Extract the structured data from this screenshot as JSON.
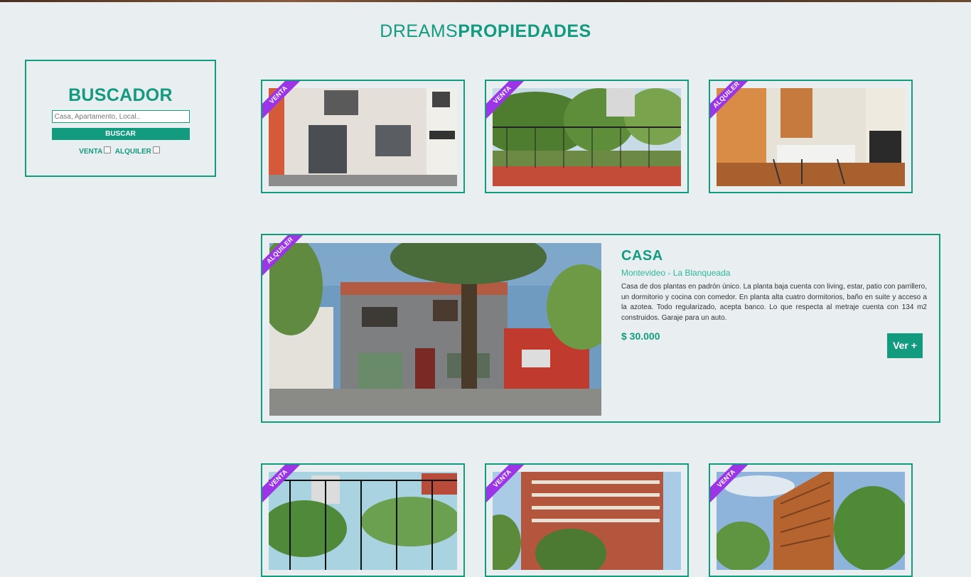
{
  "brand": {
    "light": "DREAMS",
    "bold": "PROPIEDADES"
  },
  "search": {
    "title": "BUSCADOR",
    "placeholder": "Casa, Apartamento, Local..",
    "button": "BUSCAR",
    "filter_venta": "VENTA",
    "filter_alquiler": "ALQUILER"
  },
  "listings_top": [
    {
      "tag": "VENTA"
    },
    {
      "tag": "VENTA"
    },
    {
      "tag": "ALQUILER"
    }
  ],
  "featured": {
    "tag": "ALQUILER",
    "title": "CASA",
    "location": "Montevideo - La Blanqueada",
    "description": "Casa de dos plantas en padrón único. La planta baja cuenta con living, estar, patio con parrillero, un dormitorio y cocina con comedor. En planta alta cuatro dormitorios, baño en suite y acceso a la azotea. Todo regularizado, acepta banco. Lo que respecta al metraje cuenta con 134 m2 construidos. Garaje para un auto.",
    "price": "$ 30.000",
    "button": "Ver +"
  },
  "listings_bottom": [
    {
      "tag": "VENTA"
    },
    {
      "tag": "VENTA"
    },
    {
      "tag": "VENTA"
    }
  ],
  "colors": {
    "accent": "#139b80",
    "ribbon": "#9b35e6",
    "background": "#e9eef0"
  }
}
